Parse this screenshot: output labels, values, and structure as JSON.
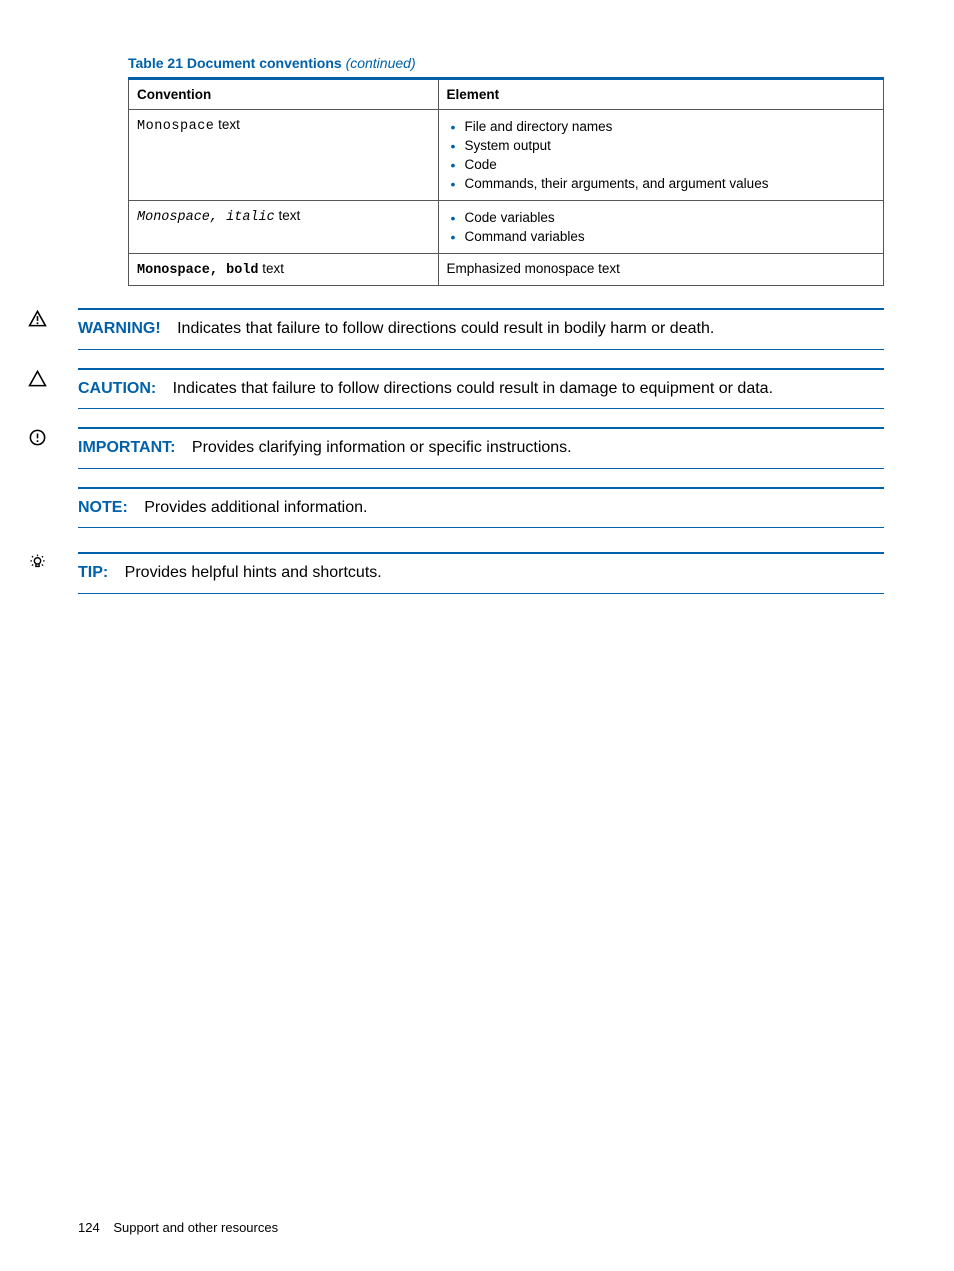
{
  "caption": {
    "prefix": "Table 21 Document conventions",
    "suffix": "(continued)"
  },
  "table": {
    "headers": [
      "Convention",
      "Element"
    ],
    "rows": [
      {
        "conv_mono": "Monospace",
        "conv_plain": " text",
        "items": [
          "File and directory names",
          "System output",
          "Code",
          "Commands, their arguments, and argument values"
        ]
      },
      {
        "conv_mono_italic": "Monospace, italic",
        "conv_plain": " text",
        "items": [
          "Code variables",
          "Command variables"
        ]
      },
      {
        "conv_mono_bold": "Monospace, bold",
        "conv_plain": " text",
        "plain_element": "Emphasized monospace text"
      }
    ]
  },
  "admonitions": [
    {
      "icon": "warning-triangle-bang",
      "label": "WARNING!",
      "text": "Indicates that failure to follow directions could result in bodily harm or death."
    },
    {
      "icon": "warning-triangle",
      "label": "CAUTION:",
      "text": "Indicates that failure to follow directions could result in damage to equipment or data."
    },
    {
      "icon": "circle-bang",
      "label": "IMPORTANT:",
      "text": "Provides clarifying information or specific instructions."
    },
    {
      "icon": "",
      "label": "NOTE:",
      "text": "Provides additional information."
    },
    {
      "icon": "tip-bulb",
      "label": "TIP:",
      "text": "Provides helpful hints and shortcuts."
    }
  ],
  "footer": {
    "page_number": "124",
    "section": "Support and other resources"
  }
}
